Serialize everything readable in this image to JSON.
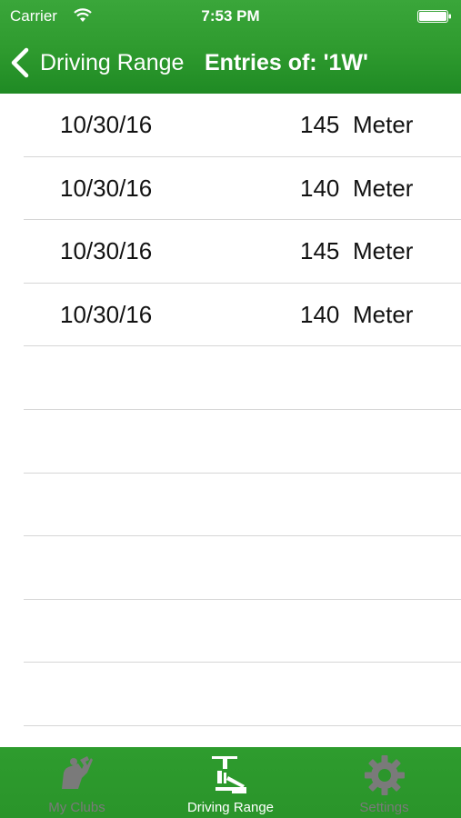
{
  "status_bar": {
    "carrier": "Carrier",
    "time": "7:53 PM"
  },
  "nav": {
    "back_label": "Driving Range",
    "title": "Entries of: '1W'"
  },
  "entries": [
    {
      "date": "10/30/16",
      "value": "145",
      "unit": "Meter"
    },
    {
      "date": "10/30/16",
      "value": "140",
      "unit": "Meter"
    },
    {
      "date": "10/30/16",
      "value": "145",
      "unit": "Meter"
    },
    {
      "date": "10/30/16",
      "value": "140",
      "unit": "Meter"
    }
  ],
  "tabs": [
    {
      "label": "My Clubs",
      "icon": "golfer-icon",
      "active": false
    },
    {
      "label": "Driving Range",
      "icon": "driving-range-icon",
      "active": true
    },
    {
      "label": "Settings",
      "icon": "gear-icon",
      "active": false
    }
  ],
  "colors": {
    "bar_green": "#2e9a2e",
    "inactive_tab": "#7a7a7a",
    "active_tab": "#ffffff"
  }
}
